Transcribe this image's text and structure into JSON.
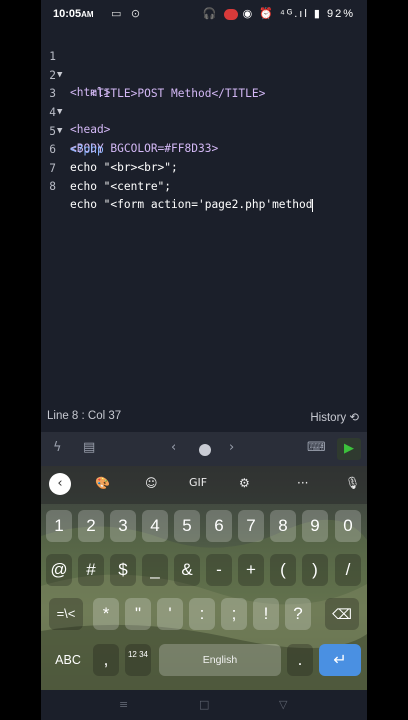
{
  "status": {
    "time": "10:05",
    "ampm": "AM",
    "battery": "92%"
  },
  "editor": {
    "lines": [
      {
        "n": "1",
        "fold": "▼",
        "text": "<html>"
      },
      {
        "n": "2",
        "fold": "",
        "text": "   <TITLE>POST Method</TITLE>"
      },
      {
        "n": "3",
        "fold": "▼",
        "text": "<head>"
      },
      {
        "n": "4",
        "fold": "▼",
        "text": "<BODY BGCOLOR=#FF8D33>"
      },
      {
        "n": "5",
        "fold": "",
        "text": "<?php"
      },
      {
        "n": "6",
        "fold": "",
        "text": "echo \"<br><br>\";"
      },
      {
        "n": "7",
        "fold": "",
        "text": "echo \"<centre\";"
      },
      {
        "n": "8",
        "fold": "",
        "text": "echo \"<form action='page2.php'method"
      }
    ],
    "position": "Line 8 : Col 37",
    "history": "History"
  },
  "keyboard": {
    "gif": "GIF",
    "row1": [
      "1",
      "2",
      "3",
      "4",
      "5",
      "6",
      "7",
      "8",
      "9",
      "0"
    ],
    "row2": [
      "@",
      "#",
      "$",
      "_",
      "&",
      "-",
      "+",
      "(",
      ")",
      "/"
    ],
    "row3": [
      "=\\<",
      "*",
      "\"",
      "'",
      ":",
      ";",
      "!",
      "?"
    ],
    "abc": "ABC",
    "comma": ",",
    "numpad": "12 34",
    "space": "English",
    "period": "."
  }
}
